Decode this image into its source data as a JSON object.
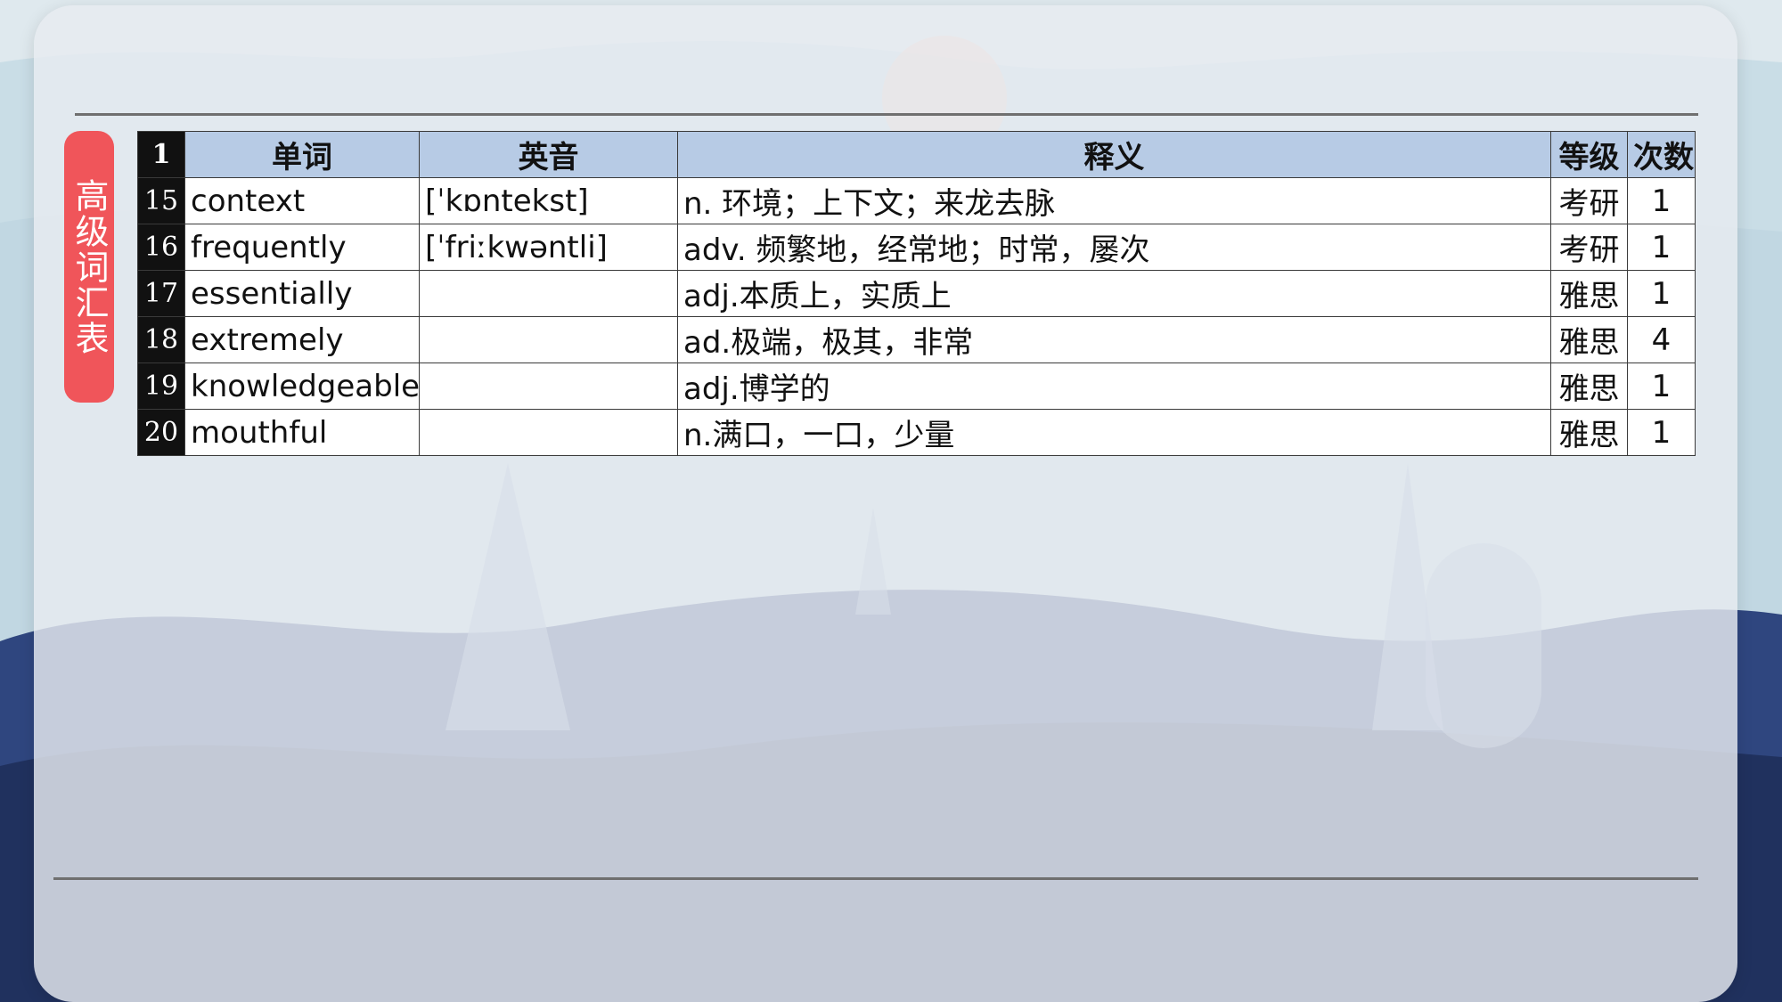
{
  "side_title": "高级词汇表",
  "table": {
    "header": {
      "index": "1",
      "word": "单词",
      "phonetic": "英音",
      "meaning": "释义",
      "level": "等级",
      "count": "次数"
    },
    "rows": [
      {
        "index": "15",
        "word": "context",
        "phonetic": "[ˈkɒntekst]",
        "meaning": "n. 环境；上下文；来龙去脉",
        "level": "考研",
        "count": "1"
      },
      {
        "index": "16",
        "word": "frequently",
        "phonetic": "[ˈfriːkwəntli]",
        "meaning": "adv. 频繁地，经常地；时常，屡次",
        "level": "考研",
        "count": "1"
      },
      {
        "index": "17",
        "word": "essentially",
        "phonetic": "",
        "meaning": "adj.本质上，实质上",
        "level": "雅思",
        "count": "1"
      },
      {
        "index": "18",
        "word": "extremely",
        "phonetic": "",
        "meaning": "ad.极端，极其，非常",
        "level": "雅思",
        "count": "4"
      },
      {
        "index": "19",
        "word": "knowledgeable",
        "phonetic": "",
        "meaning": "adj.博学的",
        "level": "雅思",
        "count": "1"
      },
      {
        "index": "20",
        "word": "mouthful",
        "phonetic": "",
        "meaning": "n.满口，一口，少量",
        "level": "雅思",
        "count": "1"
      }
    ]
  },
  "colors": {
    "title_badge": "#f0555a",
    "header_bg": "#b7cbe5",
    "index_bg": "#111111"
  }
}
